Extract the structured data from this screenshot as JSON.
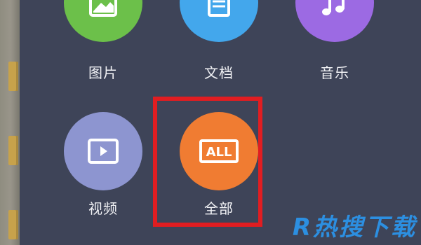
{
  "grid": {
    "items": [
      {
        "label": "图片",
        "icon": "image-icon",
        "color": "#6cc04a"
      },
      {
        "label": "文档",
        "icon": "document-icon",
        "color": "#43a7ec"
      },
      {
        "label": "音乐",
        "icon": "music-note-icon",
        "color": "#9c6ae3"
      },
      {
        "label": "视频",
        "icon": "video-play-icon",
        "color": "#8d95d0"
      },
      {
        "label": "全部",
        "icon": "all-icon",
        "color": "#f07c32"
      }
    ]
  },
  "watermark": {
    "text": "R热搜下载"
  },
  "highlight": {
    "target": "全部",
    "color": "#e11d21"
  }
}
